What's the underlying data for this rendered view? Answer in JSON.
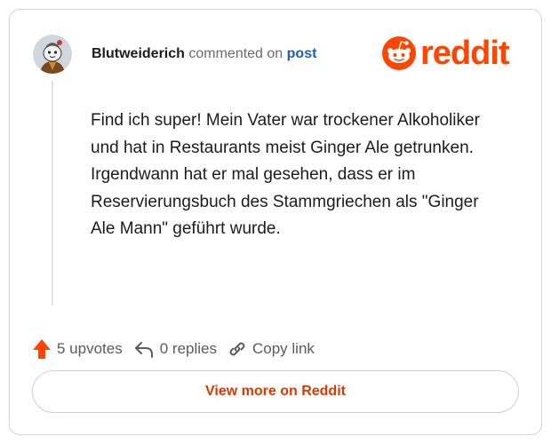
{
  "comment": {
    "author": "Blutweiderich",
    "action_text": "commented on",
    "target_link": "post",
    "body": "Find ich super! Mein Vater war trockener Alkoholiker und hat in Restaurants meist Ginger Ale getrunken. Irgendwann hat er mal gesehen, dass er im Reservierungsbuch des Stammgriechen als \"Ginger Ale Mann\" geführt wurde."
  },
  "brand": {
    "wordmark": "reddit",
    "color": "#ff4500"
  },
  "actions": {
    "upvotes": "5 upvotes",
    "replies": "0 replies",
    "copy_link": "Copy link"
  },
  "footer": {
    "view_more": "View more on Reddit"
  },
  "icons": [
    "avatar",
    "reddit-logo-icon",
    "upvote-arrow-icon",
    "reply-icon",
    "link-icon"
  ],
  "colors": {
    "accent_orange": "#ff4500",
    "link_blue": "#1a5fc0",
    "button_text": "#d93a00"
  }
}
